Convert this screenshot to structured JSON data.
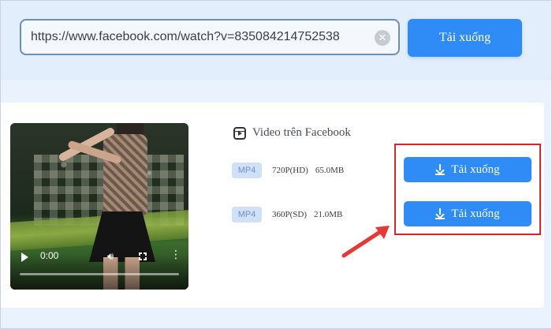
{
  "search": {
    "url_value": "https://www.facebook.com/watch?v=835084214752538",
    "clear_symbol": "✕",
    "download_label": "Tải xuống"
  },
  "result": {
    "source_label": "Video trên Facebook",
    "video": {
      "time": "0:00",
      "progress": 0
    },
    "formats": [
      {
        "badge": "MP4",
        "quality": "720P(HD)",
        "size": "65.0MB",
        "button_label": "Tải xuống"
      },
      {
        "badge": "MP4",
        "quality": "360P(SD)",
        "size": "21.0MB",
        "button_label": "Tải xuống"
      }
    ]
  },
  "colors": {
    "accent": "#2f8cf7",
    "highlight": "#d9262b",
    "badge_bg": "#cfe0f7"
  },
  "icons": [
    "clear-icon",
    "play-icon",
    "volume-icon",
    "fullscreen-icon",
    "more-icon",
    "reel-icon",
    "download-icon",
    "red-arrow"
  ]
}
